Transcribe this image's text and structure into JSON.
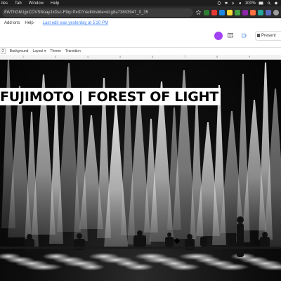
{
  "menubar": {
    "items": [
      "iles",
      "Tab",
      "Window",
      "Help"
    ],
    "battery": "100%"
  },
  "browser": {
    "url": "8WThGbUgxCDVSNoayJxDsc-Ftbp PxrDY/edit#slide=id.g8a73803947_0_35"
  },
  "slides": {
    "menu": [
      "Add-ons",
      "Help"
    ],
    "edit_status": "Last edit was yesterday at 5:30 PM",
    "present_label": "Present",
    "toolbar": [
      "Background",
      "Layout ▾",
      "Theme",
      "Transition"
    ],
    "ruler_marks": [
      "2",
      "3",
      "4",
      "5",
      "6",
      "7",
      "8",
      "9"
    ]
  },
  "slide_content": {
    "title": "FUJIMOTO | FOREST OF LIGHT"
  },
  "colors": {
    "accent": "#4285f4",
    "avatar": "#a142f4"
  }
}
